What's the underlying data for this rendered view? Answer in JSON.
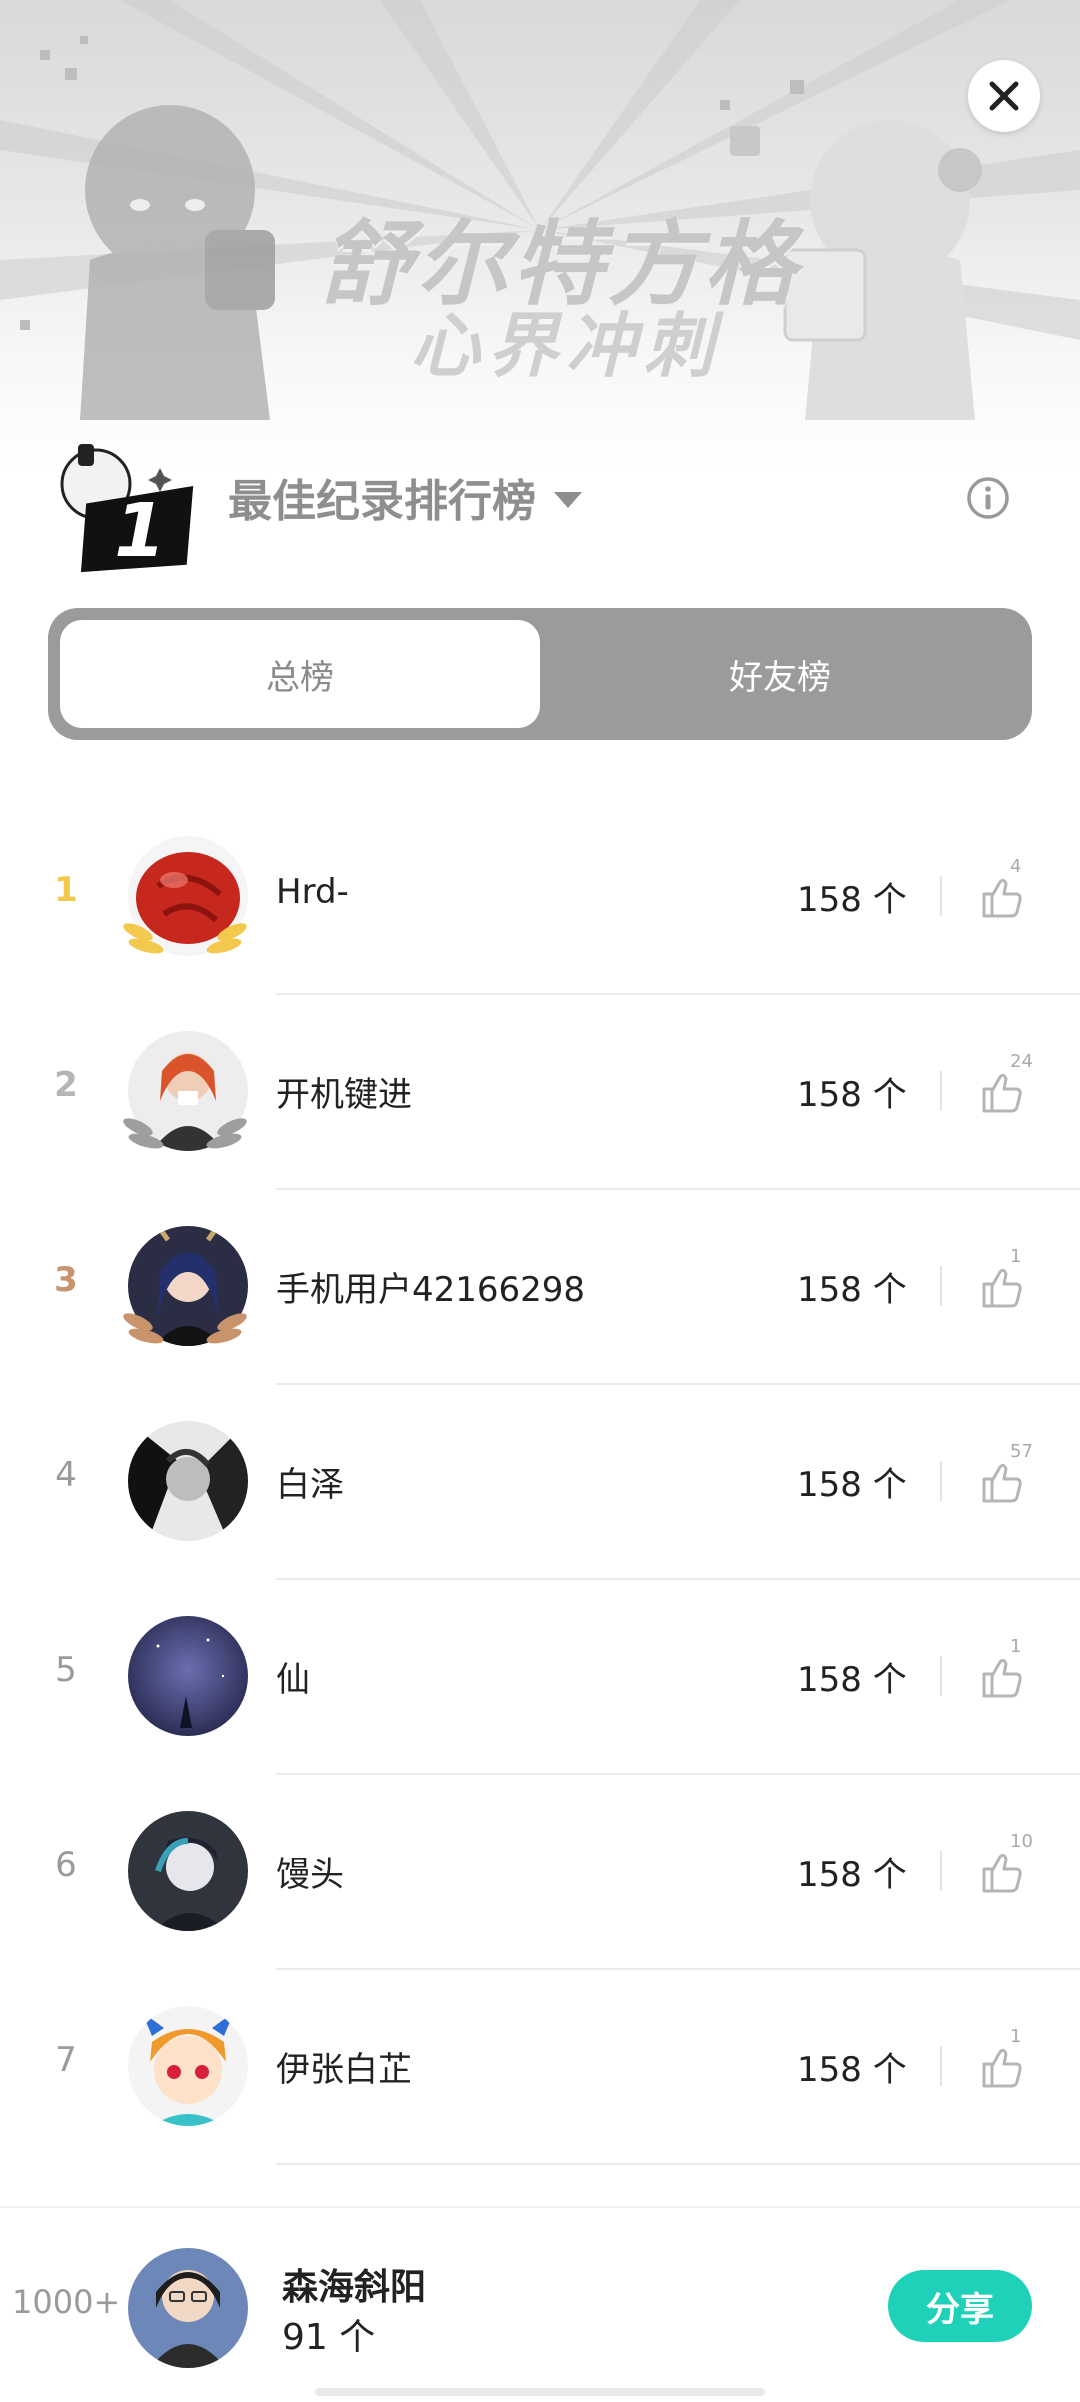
{
  "banner": {
    "title": "舒尔特方格",
    "subtitle": "心界冲刺"
  },
  "header": {
    "logo_number": "1",
    "board_title": "最佳纪录排行榜"
  },
  "tabs": [
    {
      "label": "总榜",
      "active": true
    },
    {
      "label": "好友榜",
      "active": false
    }
  ],
  "leaderboard": [
    {
      "rank": "1",
      "name": "Hrd-",
      "score": "158 个",
      "likes": "4"
    },
    {
      "rank": "2",
      "name": "开机键进",
      "score": "158 个",
      "likes": "24"
    },
    {
      "rank": "3",
      "name": "手机用户42166298",
      "score": "158 个",
      "likes": "1"
    },
    {
      "rank": "4",
      "name": "白泽",
      "score": "158 个",
      "likes": "57"
    },
    {
      "rank": "5",
      "name": "仙",
      "score": "158 个",
      "likes": "1"
    },
    {
      "rank": "6",
      "name": "馒头",
      "score": "158 个",
      "likes": "10"
    },
    {
      "rank": "7",
      "name": "伊张白芷",
      "score": "158 个",
      "likes": "1"
    }
  ],
  "self": {
    "rank": "1000+",
    "name": "森海斜阳",
    "score": "91 个",
    "share_label": "分享"
  },
  "colors": {
    "accent": "#1fd1b8",
    "gold": "#f2c94c",
    "silver": "#b5b5b5",
    "bronze": "#c9936b"
  }
}
